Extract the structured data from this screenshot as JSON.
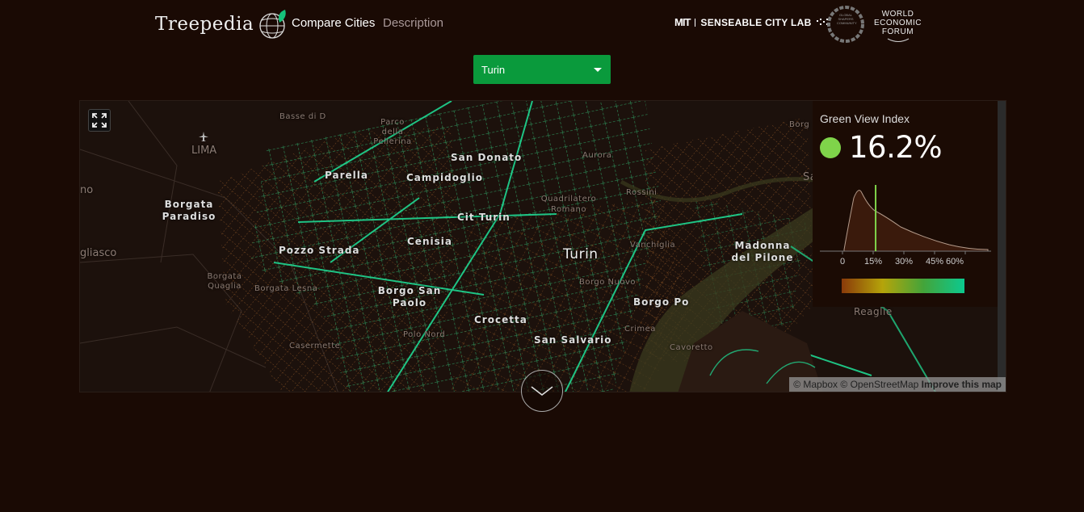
{
  "header": {
    "logo_text": "Treepedia",
    "nav": {
      "compare": "Compare Cities",
      "description": "Description"
    },
    "partners": {
      "mit": "MIT",
      "lab": "SENSEABLE CITY LAB",
      "gsc": "GLOBAL SHAPERS COMMUNITY",
      "wef": [
        "WORLD",
        "ECONOMIC",
        "FORUM"
      ]
    }
  },
  "city_select": {
    "value": "Turin"
  },
  "map": {
    "city_label": "Turin",
    "labels": [
      "San Donato",
      "Parella",
      "Campidoglio",
      "Cit Turin",
      "Borgata Paradiso",
      "Cenisia",
      "Pozzo Strada",
      "Borgo San Paolo",
      "Crocetta",
      "San Salvario",
      "Madonna del Pilone",
      "Borgo Po",
      "LIMA",
      "gliasco",
      "no"
    ],
    "small_labels": [
      "Parco della Pellerina",
      "Basse di D",
      "Aurora",
      "Quadrilatero Romano",
      "Rossini",
      "Vanchiglia",
      "Borgo Nuovo",
      "Borgata Quaglia",
      "Borgata Lesna",
      "Polo Nord",
      "Casermette",
      "Reaglie",
      "Borg",
      "Sa",
      "Crimea",
      "Cavoretto"
    ],
    "attribution": {
      "mapbox": "© Mapbox",
      "osm": "© OpenStreetMap",
      "improve": "Improve this map"
    }
  },
  "gvi_panel": {
    "title": "Green View Index",
    "value": "16.2%",
    "value_number": 16.2,
    "dot_color": "#7fd44a",
    "ticks": [
      "0",
      "15%",
      "30%",
      "45%",
      "60%"
    ],
    "gradient_colors": [
      "#8a3a0a",
      "#b5a40a",
      "#43a43a",
      "#0cc98f"
    ]
  },
  "icons": {
    "fullscreen": "fullscreen-icon",
    "scroll": "chevron-down-icon",
    "airport": "airplane-icon"
  }
}
